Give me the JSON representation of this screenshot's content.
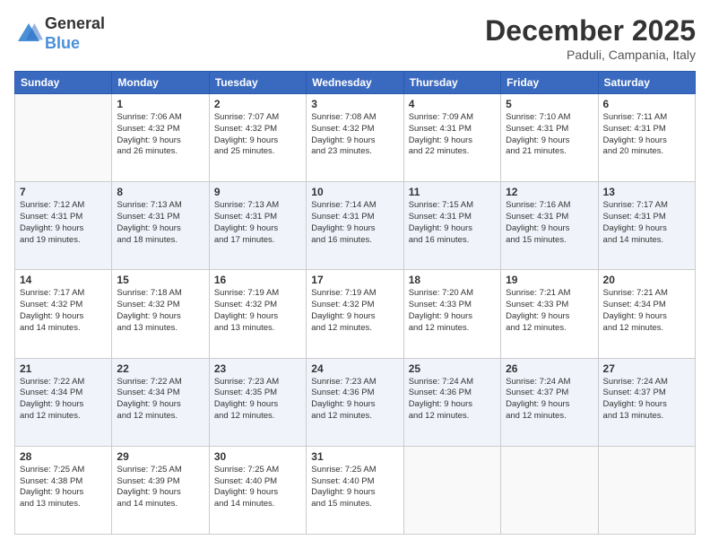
{
  "logo": {
    "general": "General",
    "blue": "Blue"
  },
  "title": "December 2025",
  "subtitle": "Paduli, Campania, Italy",
  "headers": [
    "Sunday",
    "Monday",
    "Tuesday",
    "Wednesday",
    "Thursday",
    "Friday",
    "Saturday"
  ],
  "weeks": [
    [
      {
        "day": "",
        "info": ""
      },
      {
        "day": "1",
        "info": "Sunrise: 7:06 AM\nSunset: 4:32 PM\nDaylight: 9 hours\nand 26 minutes."
      },
      {
        "day": "2",
        "info": "Sunrise: 7:07 AM\nSunset: 4:32 PM\nDaylight: 9 hours\nand 25 minutes."
      },
      {
        "day": "3",
        "info": "Sunrise: 7:08 AM\nSunset: 4:32 PM\nDaylight: 9 hours\nand 23 minutes."
      },
      {
        "day": "4",
        "info": "Sunrise: 7:09 AM\nSunset: 4:31 PM\nDaylight: 9 hours\nand 22 minutes."
      },
      {
        "day": "5",
        "info": "Sunrise: 7:10 AM\nSunset: 4:31 PM\nDaylight: 9 hours\nand 21 minutes."
      },
      {
        "day": "6",
        "info": "Sunrise: 7:11 AM\nSunset: 4:31 PM\nDaylight: 9 hours\nand 20 minutes."
      }
    ],
    [
      {
        "day": "7",
        "info": "Sunrise: 7:12 AM\nSunset: 4:31 PM\nDaylight: 9 hours\nand 19 minutes."
      },
      {
        "day": "8",
        "info": "Sunrise: 7:13 AM\nSunset: 4:31 PM\nDaylight: 9 hours\nand 18 minutes."
      },
      {
        "day": "9",
        "info": "Sunrise: 7:13 AM\nSunset: 4:31 PM\nDaylight: 9 hours\nand 17 minutes."
      },
      {
        "day": "10",
        "info": "Sunrise: 7:14 AM\nSunset: 4:31 PM\nDaylight: 9 hours\nand 16 minutes."
      },
      {
        "day": "11",
        "info": "Sunrise: 7:15 AM\nSunset: 4:31 PM\nDaylight: 9 hours\nand 16 minutes."
      },
      {
        "day": "12",
        "info": "Sunrise: 7:16 AM\nSunset: 4:31 PM\nDaylight: 9 hours\nand 15 minutes."
      },
      {
        "day": "13",
        "info": "Sunrise: 7:17 AM\nSunset: 4:31 PM\nDaylight: 9 hours\nand 14 minutes."
      }
    ],
    [
      {
        "day": "14",
        "info": "Sunrise: 7:17 AM\nSunset: 4:32 PM\nDaylight: 9 hours\nand 14 minutes."
      },
      {
        "day": "15",
        "info": "Sunrise: 7:18 AM\nSunset: 4:32 PM\nDaylight: 9 hours\nand 13 minutes."
      },
      {
        "day": "16",
        "info": "Sunrise: 7:19 AM\nSunset: 4:32 PM\nDaylight: 9 hours\nand 13 minutes."
      },
      {
        "day": "17",
        "info": "Sunrise: 7:19 AM\nSunset: 4:32 PM\nDaylight: 9 hours\nand 12 minutes."
      },
      {
        "day": "18",
        "info": "Sunrise: 7:20 AM\nSunset: 4:33 PM\nDaylight: 9 hours\nand 12 minutes."
      },
      {
        "day": "19",
        "info": "Sunrise: 7:21 AM\nSunset: 4:33 PM\nDaylight: 9 hours\nand 12 minutes."
      },
      {
        "day": "20",
        "info": "Sunrise: 7:21 AM\nSunset: 4:34 PM\nDaylight: 9 hours\nand 12 minutes."
      }
    ],
    [
      {
        "day": "21",
        "info": "Sunrise: 7:22 AM\nSunset: 4:34 PM\nDaylight: 9 hours\nand 12 minutes."
      },
      {
        "day": "22",
        "info": "Sunrise: 7:22 AM\nSunset: 4:34 PM\nDaylight: 9 hours\nand 12 minutes."
      },
      {
        "day": "23",
        "info": "Sunrise: 7:23 AM\nSunset: 4:35 PM\nDaylight: 9 hours\nand 12 minutes."
      },
      {
        "day": "24",
        "info": "Sunrise: 7:23 AM\nSunset: 4:36 PM\nDaylight: 9 hours\nand 12 minutes."
      },
      {
        "day": "25",
        "info": "Sunrise: 7:24 AM\nSunset: 4:36 PM\nDaylight: 9 hours\nand 12 minutes."
      },
      {
        "day": "26",
        "info": "Sunrise: 7:24 AM\nSunset: 4:37 PM\nDaylight: 9 hours\nand 12 minutes."
      },
      {
        "day": "27",
        "info": "Sunrise: 7:24 AM\nSunset: 4:37 PM\nDaylight: 9 hours\nand 13 minutes."
      }
    ],
    [
      {
        "day": "28",
        "info": "Sunrise: 7:25 AM\nSunset: 4:38 PM\nDaylight: 9 hours\nand 13 minutes."
      },
      {
        "day": "29",
        "info": "Sunrise: 7:25 AM\nSunset: 4:39 PM\nDaylight: 9 hours\nand 14 minutes."
      },
      {
        "day": "30",
        "info": "Sunrise: 7:25 AM\nSunset: 4:40 PM\nDaylight: 9 hours\nand 14 minutes."
      },
      {
        "day": "31",
        "info": "Sunrise: 7:25 AM\nSunset: 4:40 PM\nDaylight: 9 hours\nand 15 minutes."
      },
      {
        "day": "",
        "info": ""
      },
      {
        "day": "",
        "info": ""
      },
      {
        "day": "",
        "info": ""
      }
    ]
  ]
}
